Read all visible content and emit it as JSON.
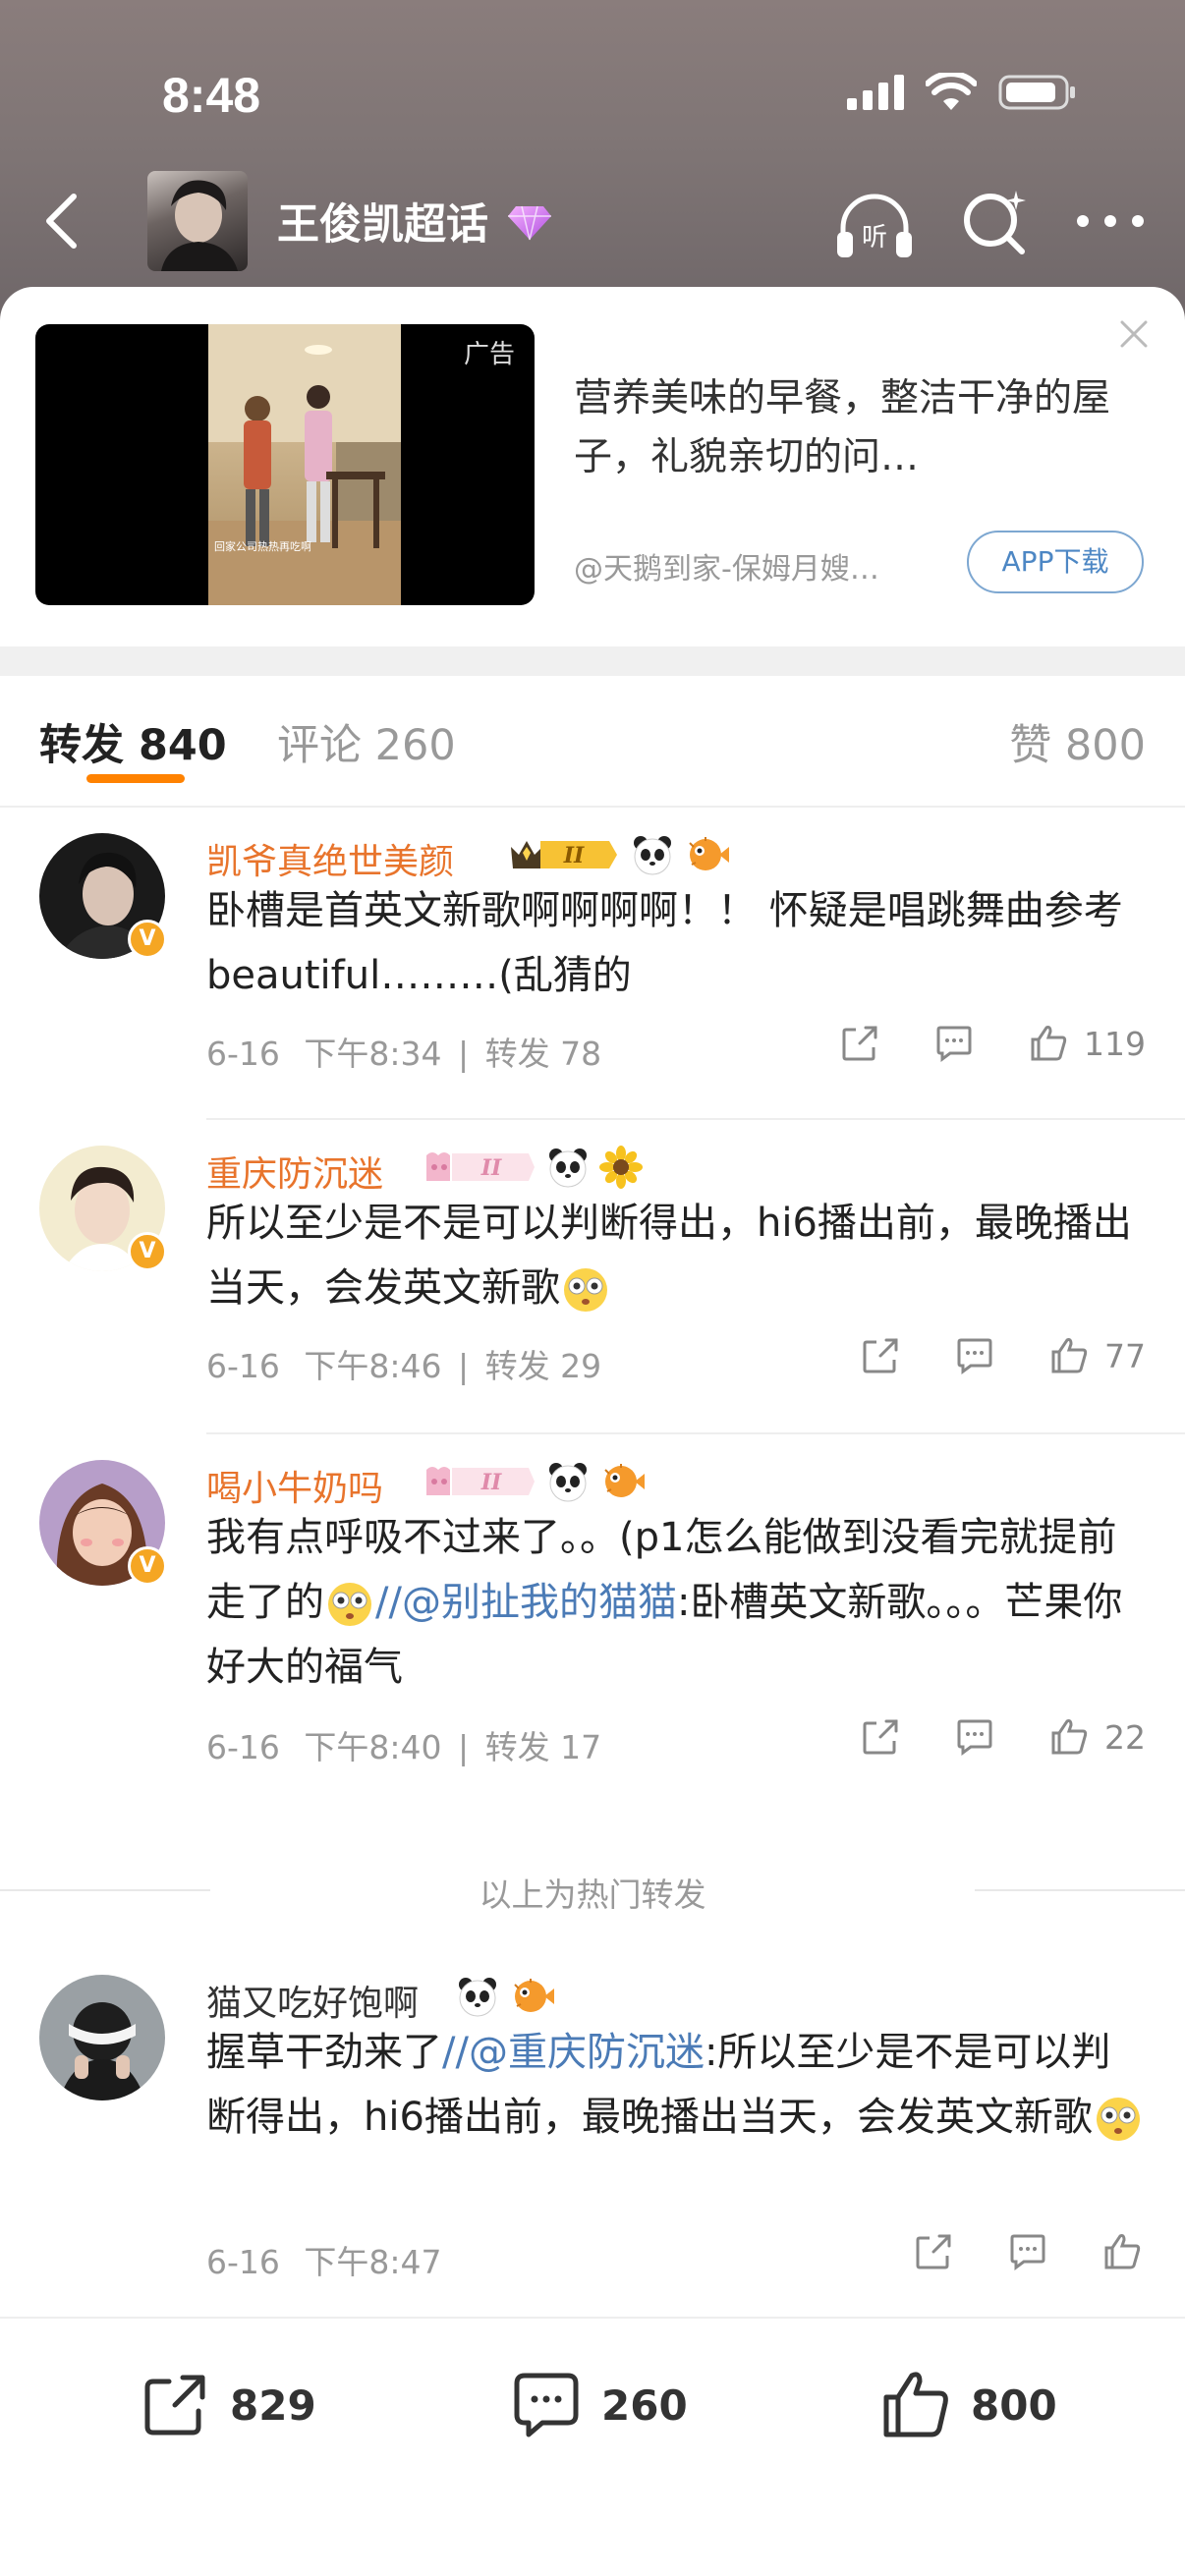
{
  "status_bar": {
    "time": "8:48"
  },
  "header": {
    "title": "王俊凯超话"
  },
  "ad": {
    "tag": "广告",
    "video_caption": "回家公司热热再吃啊",
    "text": "营养美味的早餐，整洁干净的屋子，礼貌亲切的问…",
    "source": "@天鹅到家-保姆月嫂…",
    "button": "APP下载"
  },
  "tabs": {
    "repost": "转发 840",
    "comment": "评论 260",
    "like": "赞 800"
  },
  "comments": [
    {
      "username": "凯爷真绝世美颜",
      "text": "卧槽是首英文新歌啊啊啊啊！！ 怀疑是唱跳舞曲参考 beautiful………(乱猜的",
      "date": "6-16",
      "time": "下午8:34",
      "repost_label": "转发 78",
      "likes": "119",
      "level": "II"
    },
    {
      "username": "重庆防沉迷",
      "text": "所以至少是不是可以判断得出，hi6播出前，最晚播出当天，会发英文新歌",
      "date": "6-16",
      "time": "下午8:46",
      "repost_label": "转发 29",
      "likes": "77",
      "level": "II"
    },
    {
      "username": "喝小牛奶吗",
      "text_before": "我有点呼吸不过来了。。(p1怎么能做到没看完就提前走了的",
      "mention": "//@别扯我的猫猫",
      "text_after": ":卧槽英文新歌。。。芒果你好大的福气",
      "date": "6-16",
      "time": "下午8:40",
      "repost_label": "转发 17",
      "likes": "22",
      "level": "II"
    }
  ],
  "hot_label": "以上为热门转发",
  "latest": {
    "username": "猫又吃好饱啊",
    "text_before": "握草干劲来了",
    "mention": "//@重庆防沉迷",
    "text_after": ":所以至少是不是可以判断得出，hi6播出前，最晚播出当天，会发英文新歌",
    "date": "6-16",
    "time": "下午8:47"
  },
  "bottom_bar": {
    "reposts": "829",
    "comments": "260",
    "likes": "800"
  },
  "colors": {
    "accent": "#ff8200",
    "username": "#e8742c",
    "mention": "#4b7bb6",
    "verified": "#f5a623"
  }
}
